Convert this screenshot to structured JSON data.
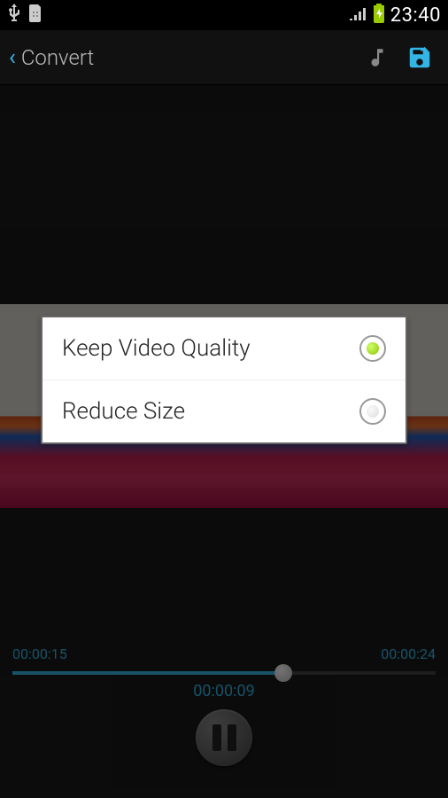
{
  "status": {
    "time": "23:40",
    "icons": {
      "usb": "usb-icon",
      "sim": "sim-icon",
      "signal": "signal-icon",
      "battery": "battery-charging-icon"
    }
  },
  "actionbar": {
    "back_chevron": "‹",
    "title": "Convert",
    "music_icon": "music-note-icon",
    "save_icon": "save-icon"
  },
  "dialog": {
    "options": [
      {
        "label": "Keep Video Quality",
        "selected": true
      },
      {
        "label": "Reduce Size",
        "selected": false
      }
    ]
  },
  "player": {
    "start_time": "00:00:15",
    "end_time": "00:00:24",
    "elapsed": "00:00:09",
    "progress_percent": 64,
    "state": "paused"
  },
  "colors": {
    "accent": "#33b5e5",
    "radio_selected": "#8bc400"
  }
}
